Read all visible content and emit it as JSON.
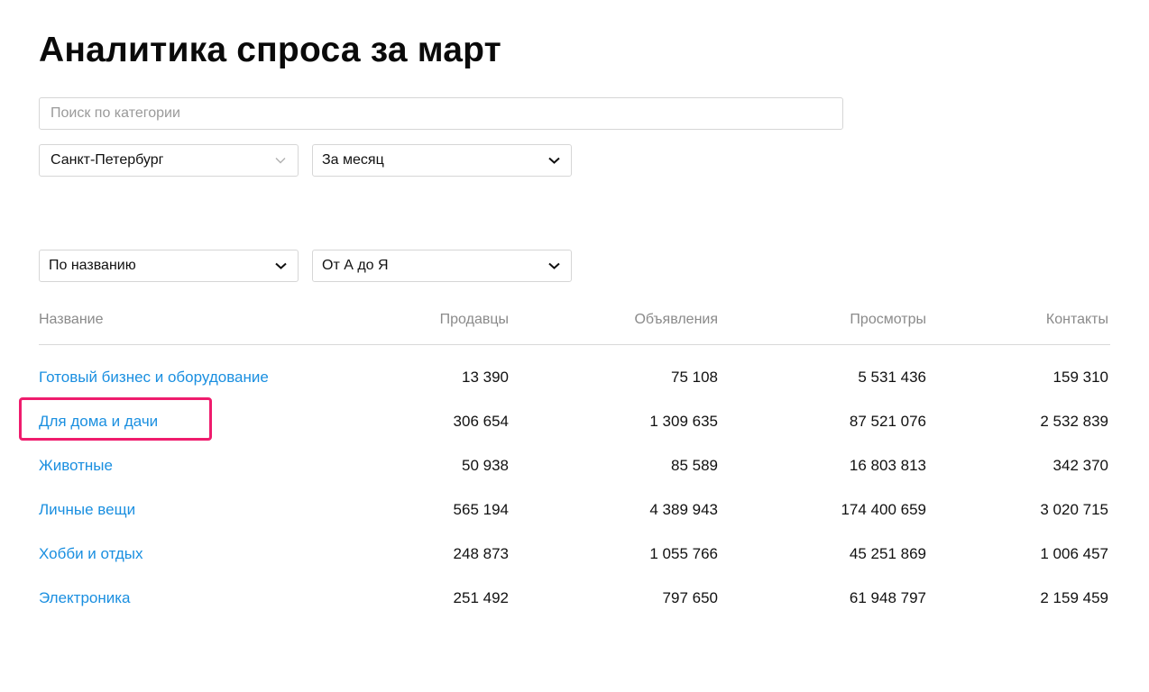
{
  "page": {
    "title": "Аналитика спроса за март"
  },
  "search": {
    "placeholder": "Поиск по категории",
    "value": ""
  },
  "filters": {
    "city": "Санкт-Петербург",
    "period": "За месяц",
    "sort_by": "По названию",
    "sort_order": "От А до Я"
  },
  "table": {
    "headers": {
      "name": "Название",
      "sellers": "Продавцы",
      "ads": "Объявления",
      "views": "Просмотры",
      "contacts": "Контакты"
    },
    "rows": [
      {
        "name": "Готовый бизнес и оборудование",
        "sellers": "13 390",
        "ads": "75 108",
        "views": "5 531 436",
        "contacts": "159 310"
      },
      {
        "name": "Для дома и дачи",
        "sellers": "306 654",
        "ads": "1 309 635",
        "views": "87 521 076",
        "contacts": "2 532 839",
        "highlighted": true
      },
      {
        "name": "Животные",
        "sellers": "50 938",
        "ads": "85 589",
        "views": "16 803 813",
        "contacts": "342 370"
      },
      {
        "name": "Личные вещи",
        "sellers": "565 194",
        "ads": "4 389 943",
        "views": "174 400 659",
        "contacts": "3 020 715"
      },
      {
        "name": "Хобби и отдых",
        "sellers": "248 873",
        "ads": "1 055 766",
        "views": "45 251 869",
        "contacts": "1 006 457"
      },
      {
        "name": "Электроника",
        "sellers": "251 492",
        "ads": "797 650",
        "views": "61 948 797",
        "contacts": "2 159 459"
      }
    ]
  },
  "icons": {
    "dropdown": "chevron-down-icon"
  },
  "colors": {
    "link": "#1a8fe0",
    "highlight": "#ef1c6d",
    "header_text": "#8a8a8a",
    "border": "#d6d6d6"
  }
}
